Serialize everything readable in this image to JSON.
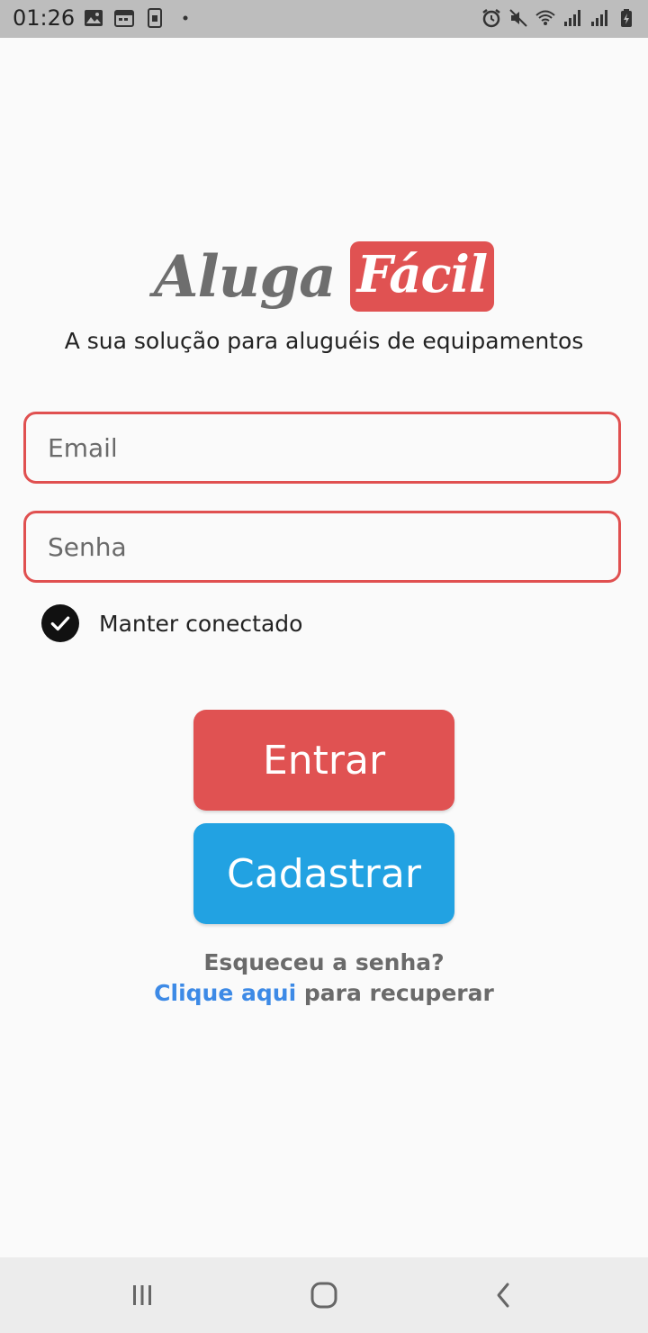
{
  "status_bar": {
    "time": "01:26",
    "left_icons": [
      "image-icon",
      "calendar-icon",
      "sim-icon",
      "dot-icon"
    ],
    "right_icons": [
      "alarm-icon",
      "mute-icon",
      "wifi-icon",
      "signal-icon",
      "signal-icon",
      "battery-charging-icon"
    ]
  },
  "logo": {
    "part1": "Aluga",
    "part2": "Fácil"
  },
  "tagline": "A sua solução para aluguéis de equipamentos",
  "form": {
    "email_placeholder": "Email",
    "password_placeholder": "Senha",
    "keep_connected_label": "Manter conectado",
    "keep_connected_checked": true
  },
  "buttons": {
    "login": "Entrar",
    "register": "Cadastrar"
  },
  "forgot": {
    "question": "Esqueceu a senha?",
    "link_text": "Clique aqui",
    "suffix": " para recuperar"
  },
  "colors": {
    "accent_red": "#e05252",
    "accent_blue": "#22a2e2",
    "link_blue": "#3d8ae6"
  },
  "nav_bar": {
    "buttons": [
      "recent-apps-icon",
      "home-icon",
      "back-icon"
    ]
  }
}
